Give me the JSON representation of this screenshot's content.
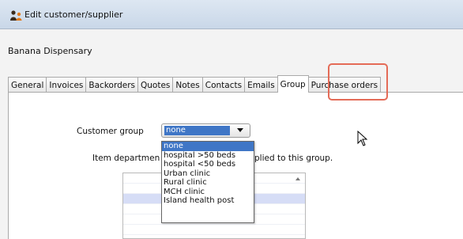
{
  "window": {
    "title": "Edit customer/supplier"
  },
  "customer": {
    "name": "Banana Dispensary"
  },
  "tabs": [
    {
      "label": "General"
    },
    {
      "label": "Invoices"
    },
    {
      "label": "Backorders"
    },
    {
      "label": "Quotes"
    },
    {
      "label": "Notes"
    },
    {
      "label": "Contacts"
    },
    {
      "label": "Emails"
    },
    {
      "label": "Group",
      "active": true
    },
    {
      "label": "Purchase orders"
    }
  ],
  "group_panel": {
    "customer_group_label": "Customer group",
    "customer_group_value": "none",
    "dept_text_prefix": "Item departmen",
    "dept_text_suffix": "plied to this group."
  },
  "dropdown": {
    "options": [
      "none",
      "hospital >50 beds",
      "hospital <50 beds",
      "Urban clinic",
      "Rural clinic",
      "MCH clinic",
      "Island health post"
    ],
    "selected": "none"
  },
  "colors": {
    "selection": "#3f76c6",
    "highlight": "#e46b57",
    "list_selected_row": "#d6ddf6"
  }
}
